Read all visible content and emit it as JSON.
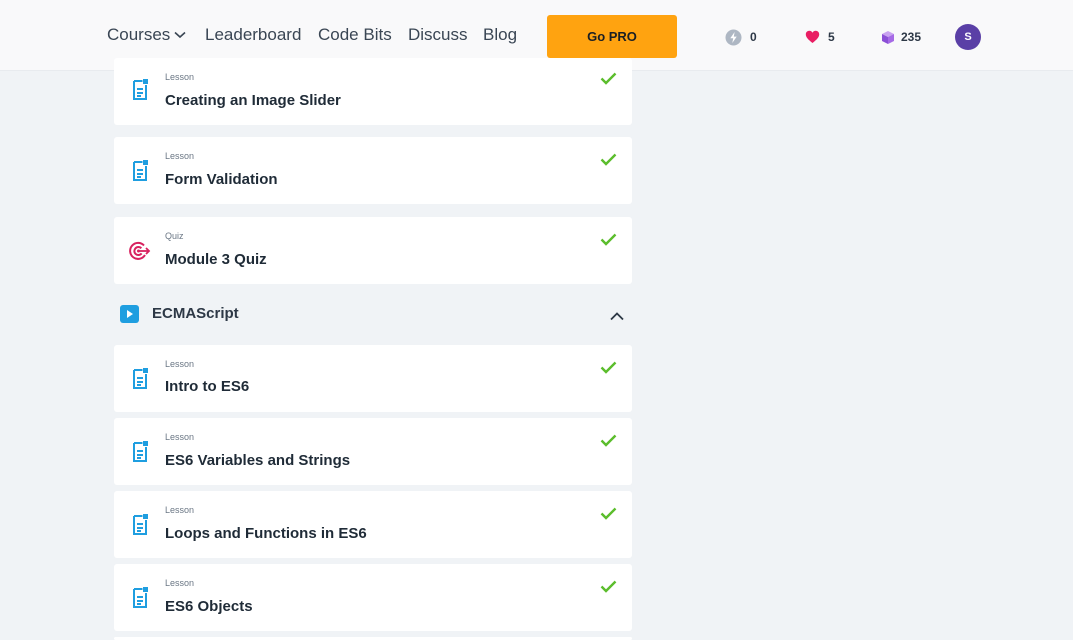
{
  "nav": {
    "courses": "Courses",
    "leaderboard": "Leaderboard",
    "code_bits": "Code Bits",
    "discuss": "Discuss",
    "blog": "Blog",
    "go_pro": "Go PRO"
  },
  "stats": {
    "bolts": "0",
    "hearts": "5",
    "gems": "235"
  },
  "user": {
    "avatar_initial": "S"
  },
  "colors": {
    "accent_orange": "#ffa310",
    "lesson_icon_blue": "#1f9ee0",
    "quiz_icon_pink": "#d8215f",
    "check_green": "#5bbd2c",
    "avatar_purple": "#5a3fa6"
  },
  "items_top": [
    {
      "kind": "Lesson",
      "title": "Creating an Image Slider",
      "icon": "lesson-doc-icon",
      "completed": true
    },
    {
      "kind": "Lesson",
      "title": "Form Validation",
      "icon": "lesson-doc-icon",
      "completed": true
    },
    {
      "kind": "Quiz",
      "title": "Module 3 Quiz",
      "icon": "quiz-target-icon",
      "completed": true
    }
  ],
  "section": {
    "title": "ECMAScript",
    "icon": "play-icon",
    "expanded": true
  },
  "items_section": [
    {
      "kind": "Lesson",
      "title": "Intro to ES6",
      "icon": "lesson-doc-icon",
      "completed": true
    },
    {
      "kind": "Lesson",
      "title": "ES6 Variables and Strings",
      "icon": "lesson-doc-icon",
      "completed": true
    },
    {
      "kind": "Lesson",
      "title": "Loops and Functions in ES6",
      "icon": "lesson-doc-icon",
      "completed": true
    },
    {
      "kind": "Lesson",
      "title": "ES6 Objects",
      "icon": "lesson-doc-icon",
      "completed": true
    }
  ]
}
